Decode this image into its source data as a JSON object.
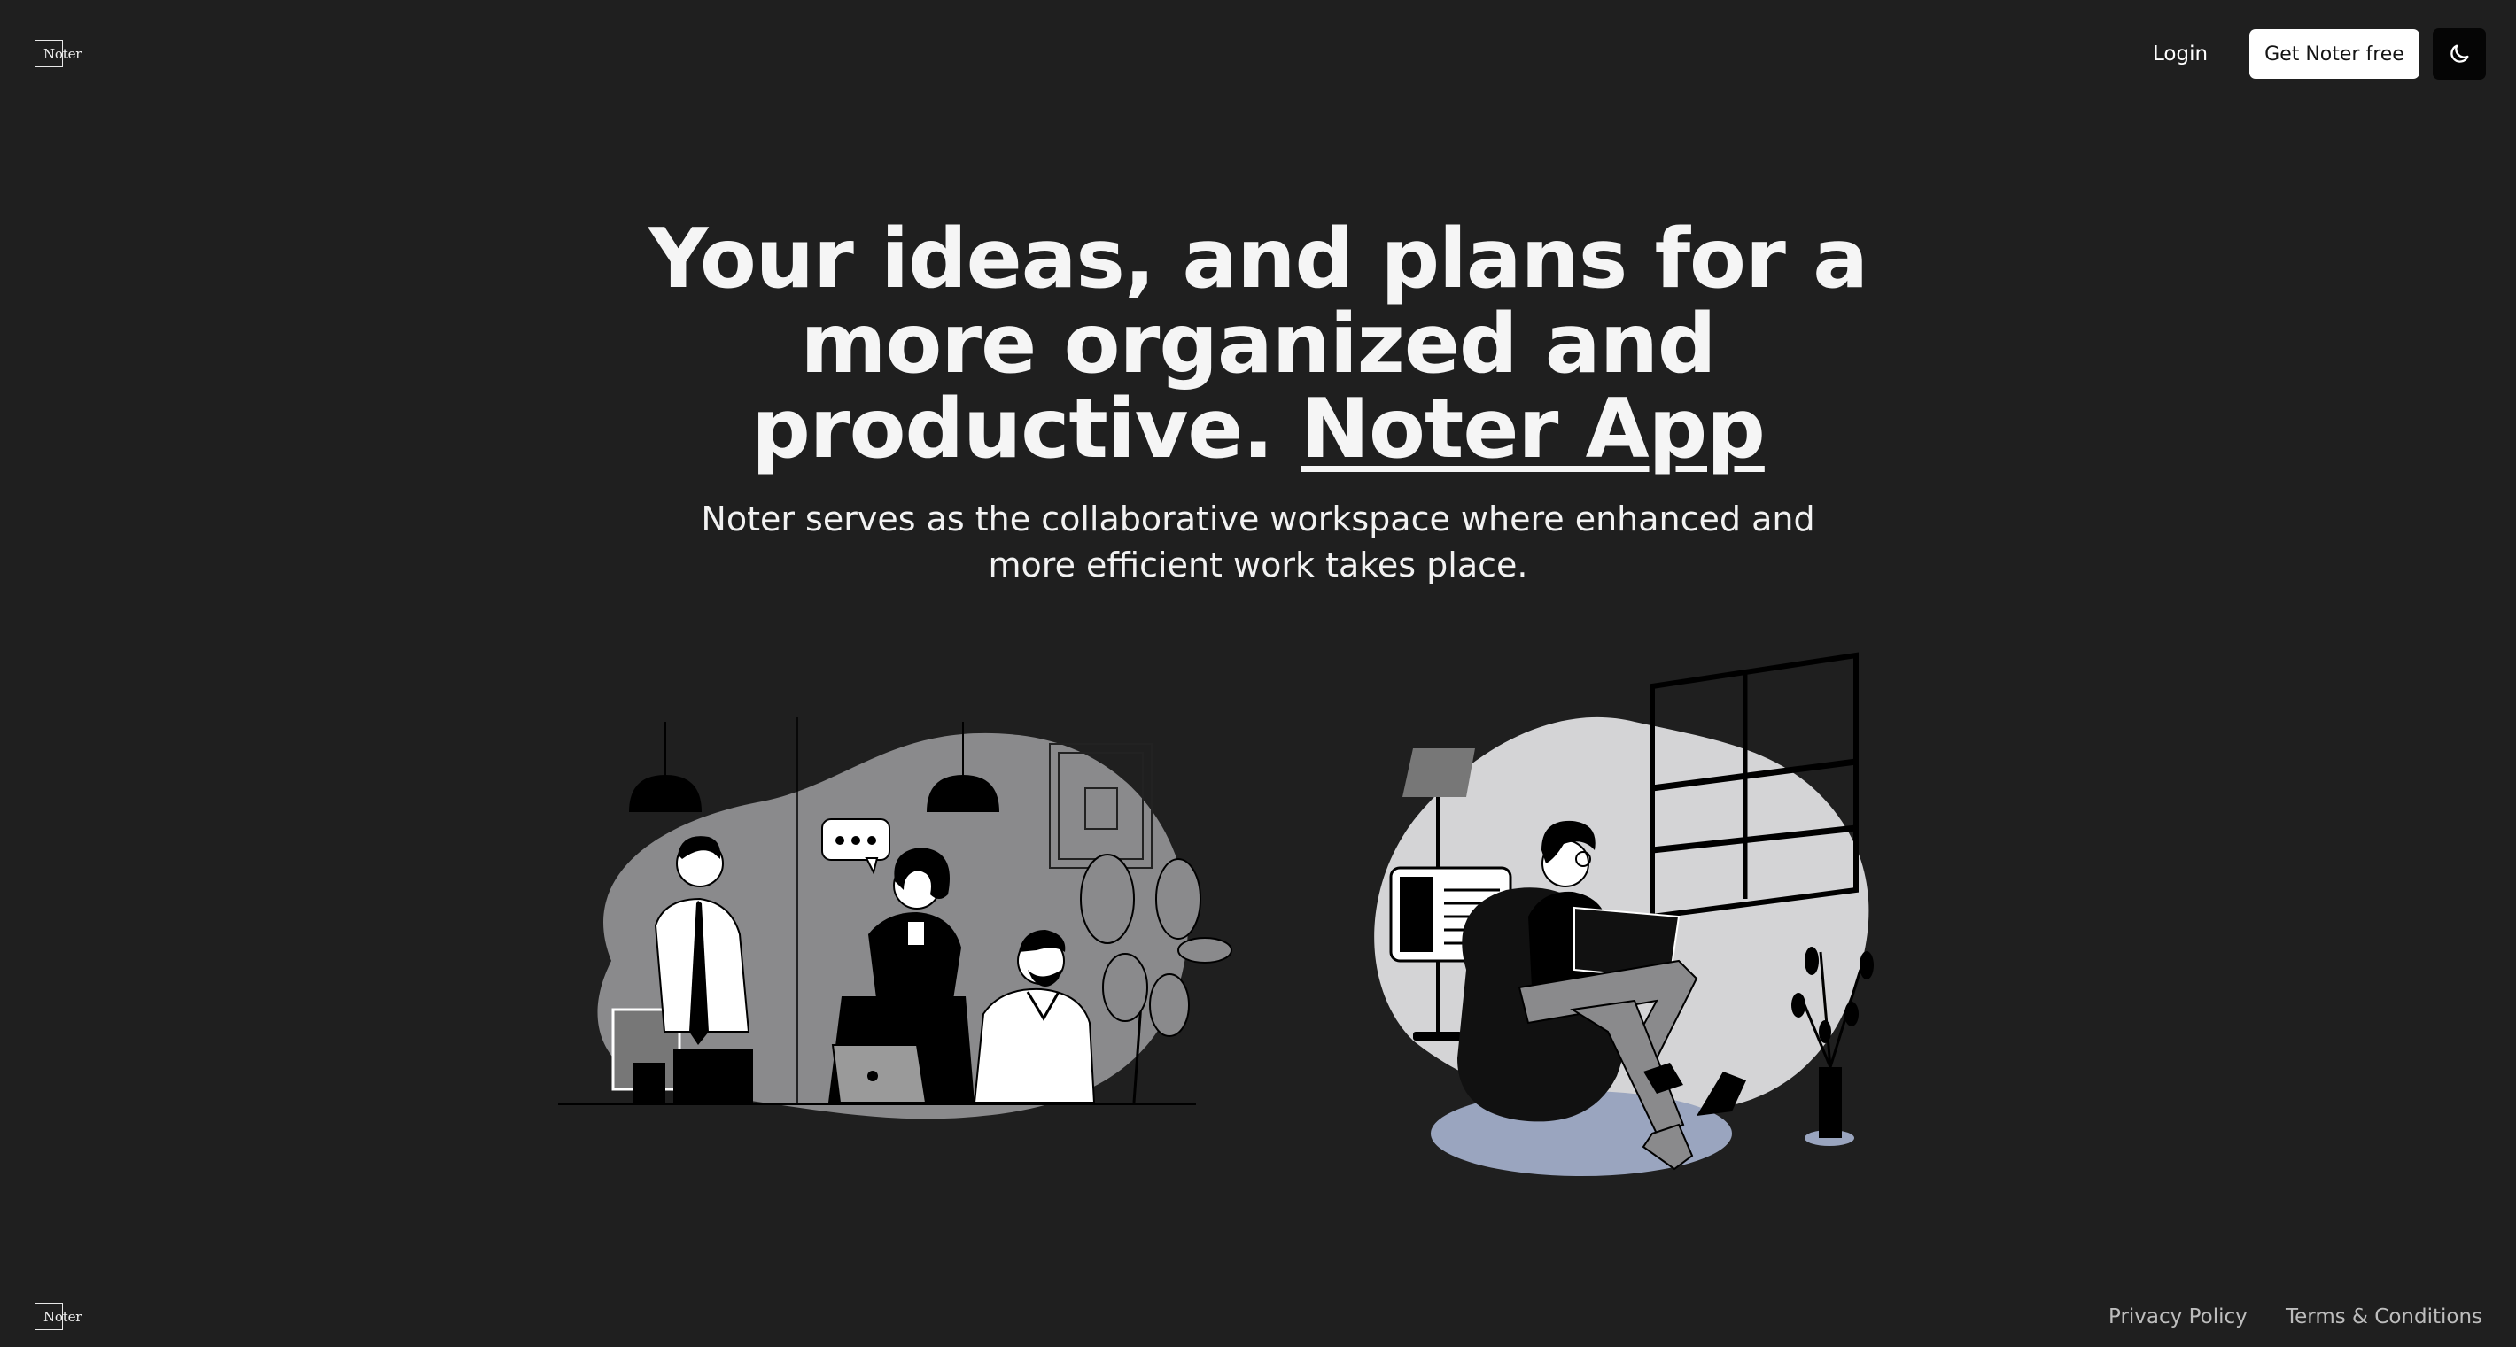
{
  "brand": {
    "logo_text": "Noter"
  },
  "nav": {
    "login_label": "Login",
    "cta_label": "Get Noter free",
    "theme_toggle_icon": "moon-icon"
  },
  "hero": {
    "title_main": "Your ideas, and plans for a more organized and productive.",
    "title_accent": "Noter App",
    "subtitle": "Noter serves as the collaborative workspace where enhanced and more efficient work takes place."
  },
  "footer": {
    "privacy_label": "Privacy Policy",
    "terms_label": "Terms & Conditions"
  },
  "colors": {
    "background": "#1f1f1f",
    "button_light": "#ffffff",
    "button_dark": "#050505",
    "illustration_blue": "#9aa5bf",
    "illustration_gray": "#8a8a8c"
  }
}
